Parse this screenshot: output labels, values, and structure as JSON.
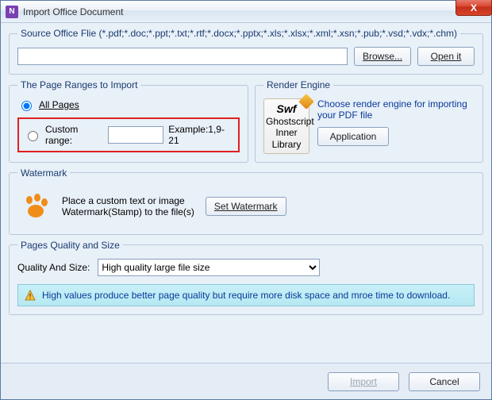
{
  "window": {
    "title": "Import Office Document",
    "close_glyph": "X"
  },
  "source": {
    "legend": "Source Office Flie (*.pdf;*.doc;*.ppt;*.txt;*.rtf;*.docx;*.pptx;*.xls;*.xlsx;*.xml;*.xsn;*.pub;*.vsd;*.vdx;*.chm)",
    "path_value": "",
    "browse_label": "Browse...",
    "open_label": "Open it"
  },
  "ranges": {
    "legend": "The Page Ranges to Import",
    "all_label": "All Pages",
    "custom_label": "Custom range:",
    "custom_value": "",
    "example_label": "Example:1,9-21"
  },
  "render": {
    "legend": "Render Engine",
    "tile_title": "Swf",
    "tile_sub1": "Ghostscript",
    "tile_sub2": "Inner Library",
    "desc": "Choose render engine for importing your PDF file",
    "app_btn": "Application"
  },
  "watermark": {
    "legend": "Watermark",
    "desc1": "Place a custom text or image",
    "desc2": "Watermark(Stamp) to the file(s)",
    "btn": "Set Watermark"
  },
  "quality": {
    "legend": "Pages Quality and Size",
    "label": "Quality And Size:",
    "selected": "High quality large file size",
    "info": "High values produce better page quality but require more disk space and mroe time to download."
  },
  "footer": {
    "import_label": "Import",
    "cancel_label": "Cancel"
  }
}
